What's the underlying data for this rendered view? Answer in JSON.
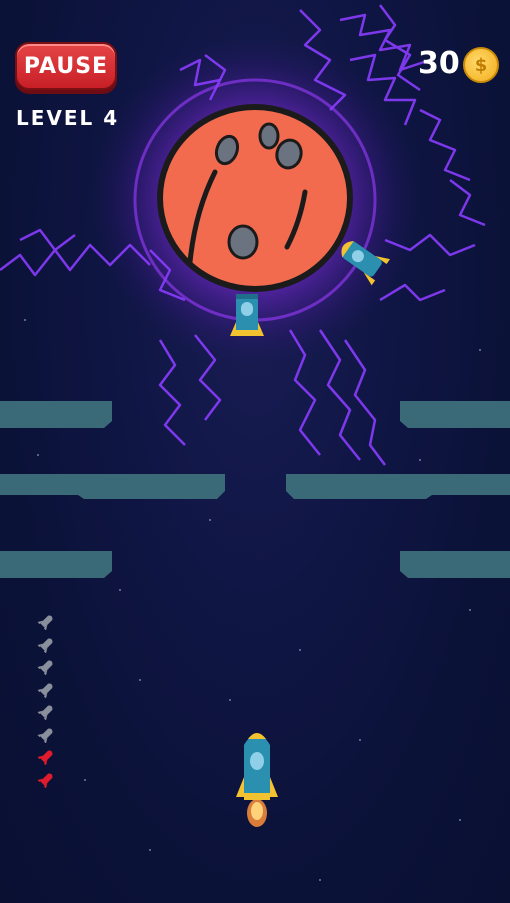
{
  "hud": {
    "pause_label": "PAUSE",
    "level_label": "LEVEL 4",
    "coin_count": "30",
    "coin_symbol": "$"
  },
  "ammo": {
    "total": 8,
    "spent": 6,
    "spent_color": "#8a8f9c",
    "remaining_color": "#e01b2c"
  },
  "colors": {
    "planet": "#f26b4f",
    "lightning": "#8a3cff",
    "barrier": "#3a6a78",
    "rocket_body": "#2b8fb0",
    "rocket_trim": "#f2c230"
  },
  "icons": {
    "boss": "planet-boss-icon",
    "player": "player-rocket-icon",
    "coin": "coin-icon",
    "ammo": "rocket-ammo-icon"
  }
}
